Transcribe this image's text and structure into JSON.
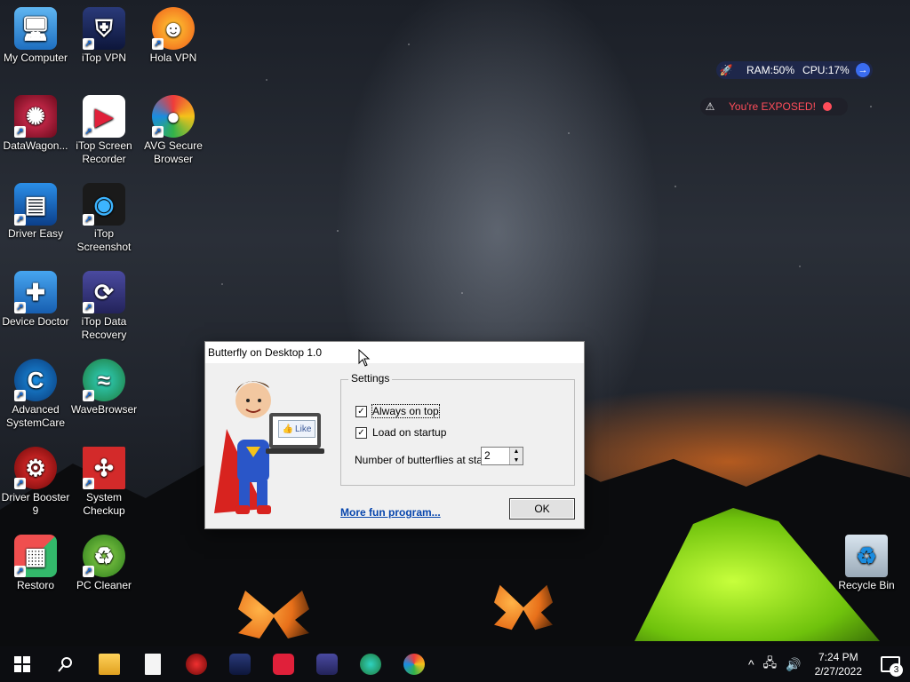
{
  "desktop": {
    "icons": [
      {
        "label": "My Computer"
      },
      {
        "label": "iTop VPN"
      },
      {
        "label": "Hola VPN"
      },
      {
        "label": "DataWagon..."
      },
      {
        "label": "iTop Screen Recorder"
      },
      {
        "label": "AVG Secure Browser"
      },
      {
        "label": "Driver Easy"
      },
      {
        "label": "iTop Screenshot"
      },
      {
        "label": "Device Doctor"
      },
      {
        "label": "iTop Data Recovery"
      },
      {
        "label": "Advanced SystemCare"
      },
      {
        "label": "WaveBrowser"
      },
      {
        "label": "Driver Booster 9"
      },
      {
        "label": "System Checkup"
      },
      {
        "label": "Restoro"
      },
      {
        "label": "PC Cleaner"
      },
      {
        "label": "Recycle Bin"
      }
    ]
  },
  "widgets": {
    "ram_label": "RAM:50%",
    "cpu_label": "CPU:17%",
    "exposed_label": "You're EXPOSED!"
  },
  "dialog": {
    "title": "Butterfly on Desktop 1.0",
    "settings_legend": "Settings",
    "always_on_top_label": "Always on top",
    "load_on_startup_label": "Load on startup",
    "number_label": "Number of butterflies at start",
    "number_value": "2",
    "like_label": "Like",
    "more_link": "More fun program...",
    "ok_label": "OK"
  },
  "taskbar": {
    "time": "7:24 PM",
    "date": "2/27/2022",
    "notifications_count": "3"
  }
}
